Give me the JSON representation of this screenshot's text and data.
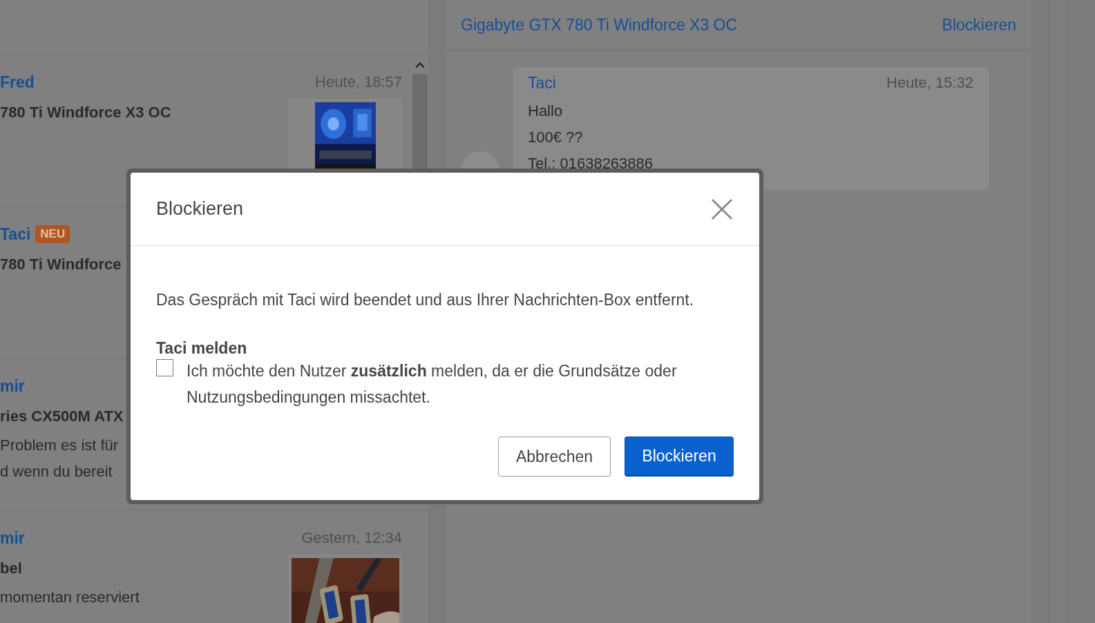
{
  "conversations": [
    {
      "name": "Fred",
      "time": "Heute, 18:57",
      "title": "780 Ti Windforce X3 OC",
      "thumbnail": {
        "kind": "picture"
      }
    },
    {
      "name": "Taci",
      "badge": "NEU",
      "title": "780 Ti Windforce"
    },
    {
      "name": "mir",
      "title": "ries CX500M ATX",
      "lines": [
        "Problem es ist für",
        "d wenn du bereit"
      ]
    },
    {
      "name": "mir",
      "time": "Gestern, 12:34",
      "title": "bel",
      "lines": [
        "momentan reserviert"
      ],
      "thumbnail": {
        "kind": "picture"
      }
    }
  ],
  "chat": {
    "title": "Gigabyte GTX 780 Ti Windforce X3 OC",
    "block_link": "Blockieren",
    "messages": [
      {
        "sender": "Taci",
        "time": "Heute, 15:32",
        "lines": [
          "Hallo",
          "100€ ??",
          "Tel.: 01638263886"
        ]
      }
    ]
  },
  "dialog": {
    "title": "Blockieren",
    "message": "Das Gespräch mit Taci wird beendet und aus Ihrer Nachrichten-Box entfernt.",
    "report_heading": "Taci melden",
    "report_checked": false,
    "report_label": "Ich möchte den Nutzer **zusätzlich** melden, da er die Grundsätze oder Nutzungsbedingungen missachtet.",
    "buttons": [
      {
        "label": "Abbrechen",
        "kind": "secondary"
      },
      {
        "label": "Blockieren",
        "kind": "primary"
      }
    ]
  }
}
